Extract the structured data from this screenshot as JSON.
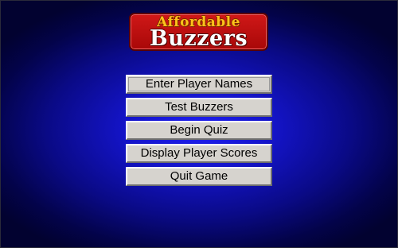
{
  "logo": {
    "line1": "Affordable",
    "line2": "Buzzers"
  },
  "menu": {
    "items": [
      {
        "label": "Enter Player Names"
      },
      {
        "label": "Test Buzzers"
      },
      {
        "label": "Begin Quiz"
      },
      {
        "label": "Display Player Scores"
      },
      {
        "label": "Quit Game"
      }
    ]
  },
  "colors": {
    "background": "#1414c8",
    "logo_red": "#c01010",
    "logo_gold": "#ffc21a",
    "button_face": "#d6d3ce"
  }
}
